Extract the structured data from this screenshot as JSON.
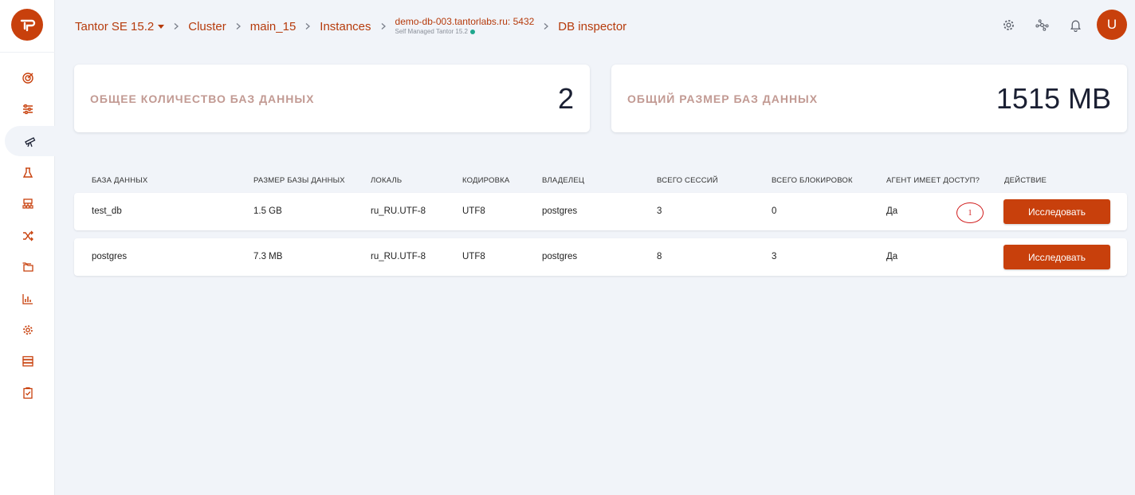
{
  "app": {
    "avatar_initial": "U",
    "brand_color": "#c8400c"
  },
  "breadcrumb": {
    "product": "Tantor SE 15.2",
    "cluster": "Cluster",
    "database_cluster": "main_15",
    "instances": "Instances",
    "instance_host": "demo-db-003.tantorlabs.ru: 5432",
    "instance_sub": "Self Managed Tantor 15.2",
    "current": "DB inspector"
  },
  "sidebar": {
    "items": [
      {
        "icon": "target-icon"
      },
      {
        "icon": "sliders-icon"
      },
      {
        "icon": "telescope-icon",
        "active": true
      },
      {
        "icon": "flask-icon"
      },
      {
        "icon": "hierarchy-icon"
      },
      {
        "icon": "shuffle-icon"
      },
      {
        "icon": "folders-icon"
      },
      {
        "icon": "bar-chart-icon"
      },
      {
        "icon": "gear-icon"
      },
      {
        "icon": "server-icon"
      },
      {
        "icon": "checklist-icon"
      }
    ]
  },
  "header_icons": [
    "settings-icon",
    "network-icon",
    "bell-icon"
  ],
  "stats": {
    "db_count_label": "ОБЩЕЕ КОЛИЧЕСТВО БАЗ ДАННЫХ",
    "db_count_value": "2",
    "db_size_label": "ОБЩИЙ РАЗМЕР БАЗ ДАННЫХ",
    "db_size_value": "1515 MB"
  },
  "table": {
    "headers": {
      "db": "БАЗА ДАННЫХ",
      "size": "РАЗМЕР БАЗЫ ДАННЫХ",
      "locale": "ЛОКАЛЬ",
      "encoding": "КОДИРОВКА",
      "owner": "ВЛАДЕЛЕЦ",
      "sessions": "ВСЕГО СЕССИЙ",
      "locks": "ВСЕГО БЛОКИРОВОК",
      "access": "АГЕНТ ИМЕЕТ ДОСТУП?",
      "action": "ДЕЙСТВИЕ"
    },
    "rows": [
      {
        "db": "test_db",
        "size": "1.5 GB",
        "locale": "ru_RU.UTF-8",
        "encoding": "UTF8",
        "owner": "postgres",
        "sessions": "3",
        "locks": "0",
        "access": "Да",
        "action": "Исследовать",
        "marker": "1"
      },
      {
        "db": "postgres",
        "size": "7.3 MB",
        "locale": "ru_RU.UTF-8",
        "encoding": "UTF8",
        "owner": "postgres",
        "sessions": "8",
        "locks": "3",
        "access": "Да",
        "action": "Исследовать"
      }
    ]
  }
}
